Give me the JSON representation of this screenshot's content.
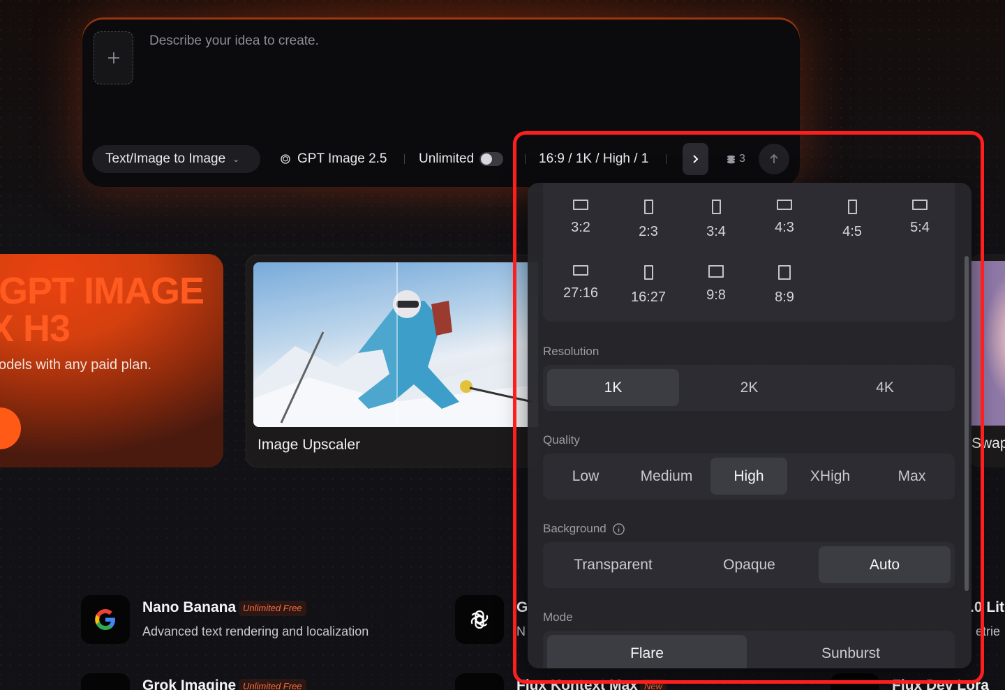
{
  "composer": {
    "placeholder": "Describe your idea to create.",
    "mode_label": "Text/Image to Image",
    "model_label": "GPT Image 2.5",
    "unlimited_label": "Unlimited",
    "settings_summary": "16:9 / 1K / High / 1",
    "settings_truncated": "A",
    "credits": "3"
  },
  "cards": {
    "promo_line1": "GPT IMAGE",
    "promo_line2": "X H3",
    "promo_sub": "odels with any paid plan.",
    "upscaler_label": "Image Upscaler",
    "faceswap_label": "Swap"
  },
  "models": [
    {
      "name": "Nano Banana",
      "badge": "Unlimited Free",
      "desc": "Advanced text rendering and localization",
      "logo": "google-logo"
    },
    {
      "name": "G",
      "desc": "N",
      "logo": "openai-logo"
    },
    {
      "name": "Grok Imagine",
      "badge": "Unlimited Free",
      "logo": "grok-logo"
    },
    {
      "name": "Flux Kontext Max",
      "badge": "New"
    },
    {
      "name": ".0 Lit",
      "desc": "etrie"
    },
    {
      "name": "Flux Dev Lora"
    }
  ],
  "panel": {
    "ratios": [
      {
        "label": "3:2",
        "orientation": "landscape"
      },
      {
        "label": "2:3",
        "orientation": "portrait"
      },
      {
        "label": "3:4",
        "orientation": "portrait"
      },
      {
        "label": "4:3",
        "orientation": "landscape"
      },
      {
        "label": "4:5",
        "orientation": "portrait"
      },
      {
        "label": "5:4",
        "orientation": "landscape"
      },
      {
        "label": "27:16",
        "orientation": "landscape"
      },
      {
        "label": "16:27",
        "orientation": "portrait"
      },
      {
        "label": "9:8",
        "orientation": "landscape"
      },
      {
        "label": "8:9",
        "orientation": "portrait"
      }
    ],
    "resolution_label": "Resolution",
    "resolution_options": [
      "1K",
      "2K",
      "4K"
    ],
    "resolution_selected": "1K",
    "quality_label": "Quality",
    "quality_options": [
      "Low",
      "Medium",
      "High",
      "XHigh",
      "Max"
    ],
    "quality_selected": "High",
    "background_label": "Background",
    "background_options": [
      "Transparent",
      "Opaque",
      "Auto"
    ],
    "background_selected": "Auto",
    "mode_label": "Mode",
    "mode_options": [
      "Flare",
      "Sunburst"
    ],
    "mode_selected": "Flare"
  },
  "colors": {
    "accent": "#ff5a1f",
    "highlight": "#ff1e1e",
    "badge_text": "#ff6a3c"
  }
}
